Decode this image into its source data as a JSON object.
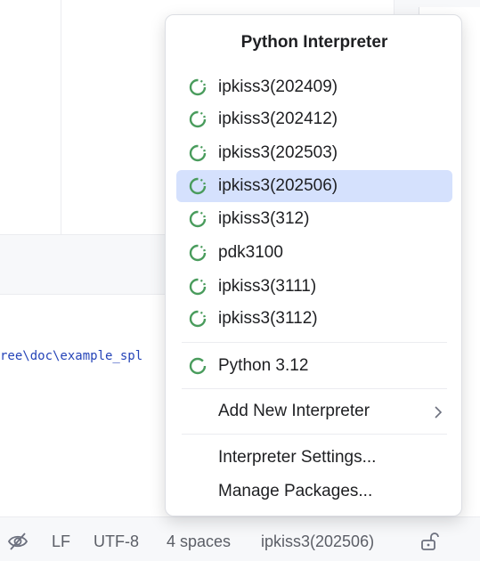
{
  "popup": {
    "title": "Python Interpreter",
    "interpreters": [
      {
        "name": "ipkiss3(202409)",
        "selected": false
      },
      {
        "name": "ipkiss3(202412)",
        "selected": false
      },
      {
        "name": "ipkiss3(202503)",
        "selected": false
      },
      {
        "name": "ipkiss3(202506)",
        "selected": true
      },
      {
        "name": "ipkiss3(312)",
        "selected": false
      },
      {
        "name": "pdk3100",
        "selected": false
      },
      {
        "name": "ipkiss3(3111)",
        "selected": false
      },
      {
        "name": "ipkiss3(3112)",
        "selected": false
      }
    ],
    "system_interpreter": "Python 3.12",
    "add_new": "Add New Interpreter",
    "settings": "Interpreter Settings...",
    "manage_packages": "Manage Packages..."
  },
  "console": {
    "path_text": "ree\\doc\\example_spl"
  },
  "statusbar": {
    "line_separator": "LF",
    "encoding": "UTF-8",
    "indent": "4 spaces",
    "interpreter": "ipkiss3(202506)"
  },
  "colors": {
    "accent_green": "#4a9c5d",
    "selection": "#d5e1fd",
    "path_blue": "#2544b8"
  },
  "icons": {
    "interpreter": "conda-env-ring-icon",
    "statusbar_left": "eye-slash-icon",
    "statusbar_right": "unlock-icon",
    "submenu": "chevron-right-icon"
  }
}
